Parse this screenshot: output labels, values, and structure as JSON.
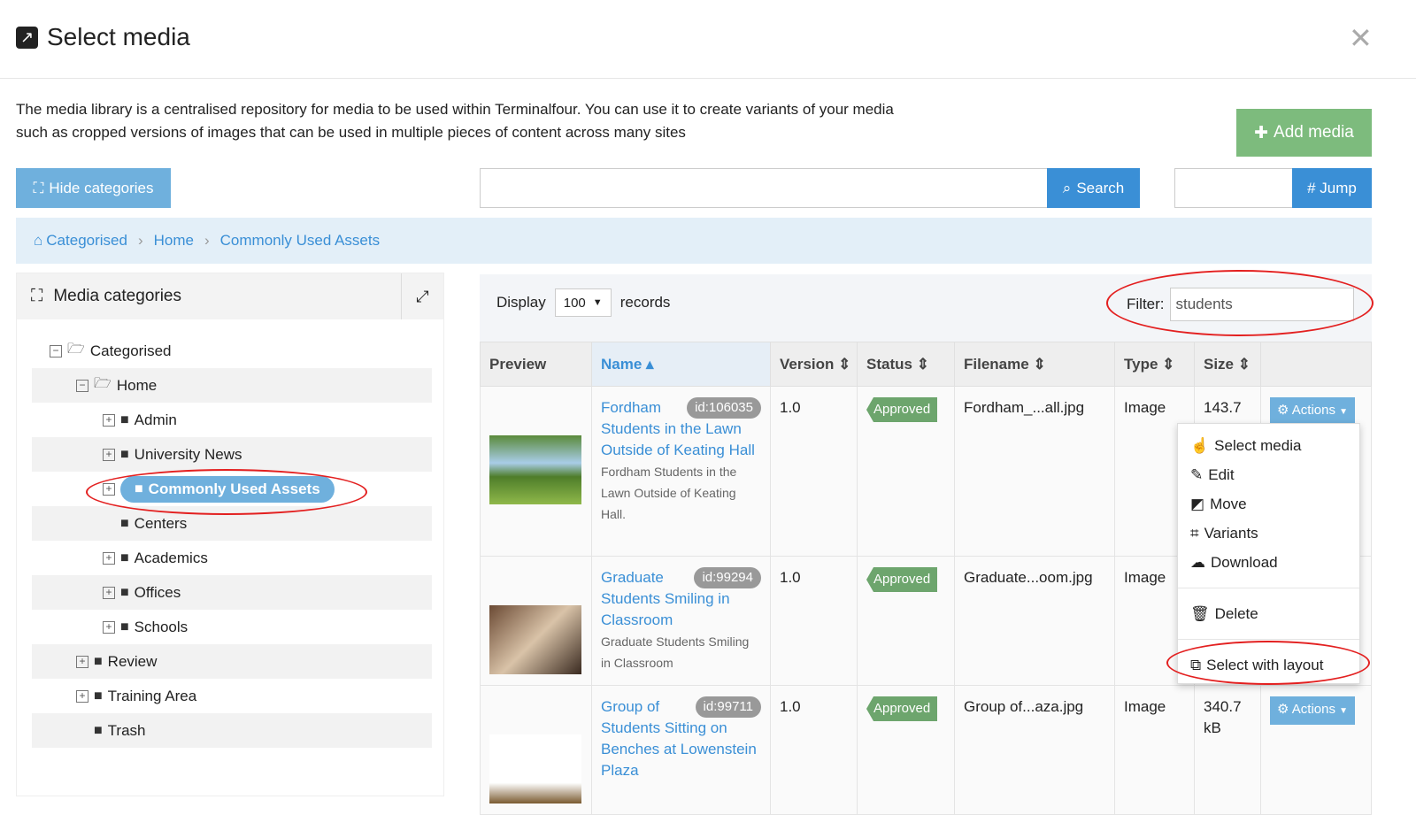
{
  "dialog": {
    "title": "Select media",
    "description": "The media library is a centralised repository for media to be used within Terminalfour. You can use it to create variants of your media such as cropped versions of images that can be used in multiple pieces of content across many sites"
  },
  "toolbar": {
    "add_media": "Add media",
    "hide_categories": "Hide categories",
    "search_value": "",
    "search": "Search",
    "jump_value": "",
    "jump": "# Jump"
  },
  "breadcrumb": [
    "Categorised",
    "Home",
    "Commonly Used Assets"
  ],
  "categories": {
    "title": "Media categories",
    "tree": [
      {
        "label": "Categorised",
        "level": 0,
        "toggle": "minus",
        "open": true
      },
      {
        "label": "Home",
        "level": 1,
        "toggle": "minus",
        "open": true
      },
      {
        "label": "Admin",
        "level": 2,
        "toggle": "plus"
      },
      {
        "label": "University News",
        "level": 2,
        "toggle": "plus"
      },
      {
        "label": "Commonly Used Assets",
        "level": 2,
        "toggle": "plus",
        "selected": true
      },
      {
        "label": "Centers",
        "level": 2,
        "toggle": ""
      },
      {
        "label": "Academics",
        "level": 2,
        "toggle": "plus"
      },
      {
        "label": "Offices",
        "level": 2,
        "toggle": "plus"
      },
      {
        "label": "Schools",
        "level": 2,
        "toggle": "plus"
      },
      {
        "label": "Review",
        "level": 1,
        "toggle": "plus"
      },
      {
        "label": "Training Area",
        "level": 1,
        "toggle": "plus"
      },
      {
        "label": "Trash",
        "level": 1,
        "toggle": ""
      }
    ]
  },
  "list": {
    "display_label": "Display",
    "display_value": "100",
    "records_label": "records",
    "filter_label": "Filter:",
    "filter_value": "students",
    "columns": [
      "Preview",
      "Name",
      "Version",
      "Status",
      "Filename",
      "Type",
      "Size"
    ],
    "rows": [
      {
        "name": "Fordham Students in the Lawn Outside of Keating Hall",
        "id": "id:106035",
        "description": "Fordham Students in the Lawn Outside of Keating Hall.",
        "version": "1.0",
        "status": "Approved",
        "filename": "Fordham_...all.jpg",
        "type": "Image",
        "size": "143.7 kB",
        "actions": "Actions"
      },
      {
        "name": "Graduate Students Smiling in Classroom",
        "id": "id:99294",
        "description": "Graduate Students Smiling in Classroom",
        "version": "1.0",
        "status": "Approved",
        "filename": "Graduate...oom.jpg",
        "type": "Image",
        "size": "",
        "actions": "Actions"
      },
      {
        "name": "Group of Students Sitting on Benches at Lowenstein Plaza",
        "id": "id:99711",
        "description": "",
        "version": "1.0",
        "status": "Approved",
        "filename": "Group of...aza.jpg",
        "type": "Image",
        "size": "340.7 kB",
        "actions": "Actions"
      }
    ]
  },
  "actions_menu": [
    "Select media",
    "Edit",
    "Move",
    "Variants",
    "Download",
    "Delete",
    "Select with layout"
  ],
  "colors": {
    "primary": "#3a8fd6",
    "approved": "#6da56d",
    "highlight": "#e32020"
  }
}
